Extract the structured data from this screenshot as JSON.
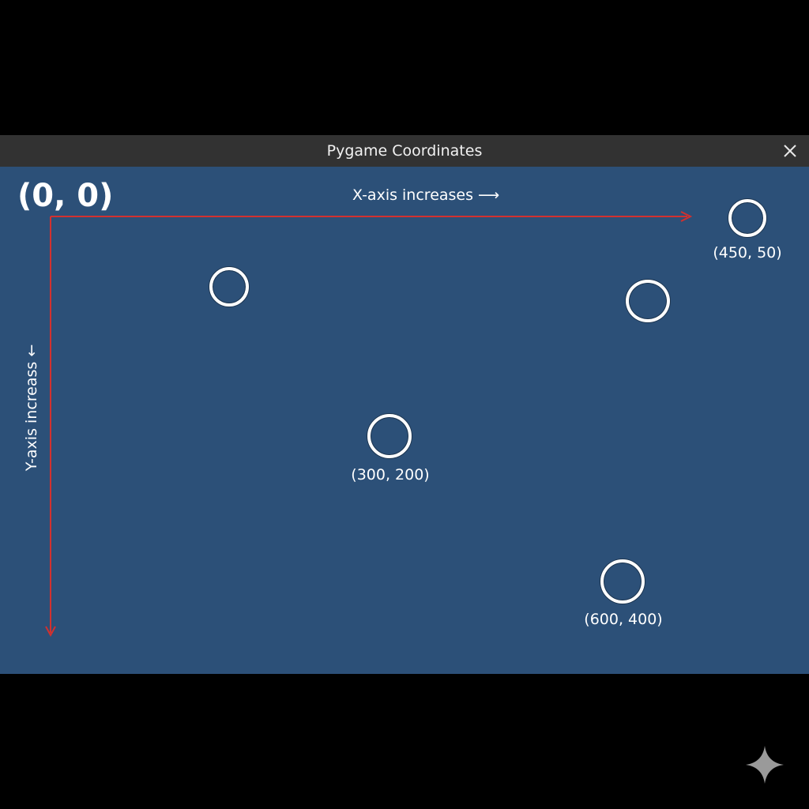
{
  "window": {
    "title": "Pygame Coordinates",
    "close_icon": "close-icon"
  },
  "canvas": {
    "background": "#2c5078",
    "axis_color": "#d2312f",
    "origin_label": "(0, 0)",
    "x_axis_label": "X-axis increases ⟶",
    "y_axis_label": "Y-axis increass ←"
  },
  "points": [
    {
      "name": "circle-1",
      "label": ""
    },
    {
      "name": "circle-450-50",
      "label": "(450, 50)"
    },
    {
      "name": "circle-3",
      "label": ""
    },
    {
      "name": "circle-300-200",
      "label": "(300, 200)"
    },
    {
      "name": "circle-600-400",
      "label": "(600, 400)"
    }
  ],
  "watermark": {
    "icon": "sparkle-icon"
  }
}
